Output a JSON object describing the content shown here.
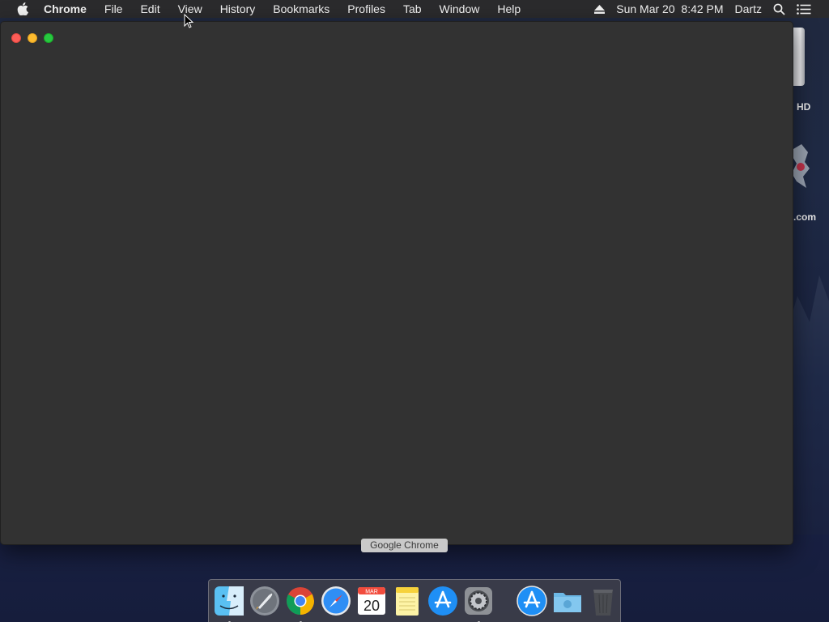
{
  "menubar": {
    "apple_icon": "apple-logo-icon",
    "app_name": "Chrome",
    "items": [
      "File",
      "Edit",
      "View",
      "History",
      "Bookmarks",
      "Profiles",
      "Tab",
      "Window",
      "Help"
    ],
    "clock": "Sun Mar 20  8:42 PM",
    "user": "Dartz",
    "status_icons": [
      "eject-icon",
      "spotlight-search-icon",
      "notification-center-icon"
    ]
  },
  "desktop": {
    "disk_label": "HD",
    "item2_label": ".com"
  },
  "window": {
    "background": "#323232",
    "traffic_lights": [
      "#fc5d57",
      "#fdbb2e",
      "#27c840"
    ]
  },
  "dock": {
    "tooltip": "Google Chrome",
    "apps": [
      {
        "name": "Finder",
        "icon": "finder-icon",
        "running": true
      },
      {
        "name": "Launchpad",
        "icon": "launchpad-icon",
        "running": false
      },
      {
        "name": "Google Chrome",
        "icon": "chrome-icon",
        "running": true
      },
      {
        "name": "Safari",
        "icon": "safari-icon",
        "running": false
      },
      {
        "name": "Calendar",
        "icon": "calendar-icon",
        "running": false,
        "month": "MAR",
        "day": "20"
      },
      {
        "name": "Notes",
        "icon": "notes-icon",
        "running": false
      },
      {
        "name": "App Store",
        "icon": "app-store-icon",
        "running": false
      },
      {
        "name": "System Preferences",
        "icon": "system-preferences-icon",
        "running": true
      }
    ],
    "right_items": [
      {
        "name": "App Store",
        "icon": "app-store-icon"
      },
      {
        "name": "Downloads",
        "icon": "downloads-folder-icon"
      },
      {
        "name": "Trash",
        "icon": "trash-icon"
      }
    ]
  }
}
